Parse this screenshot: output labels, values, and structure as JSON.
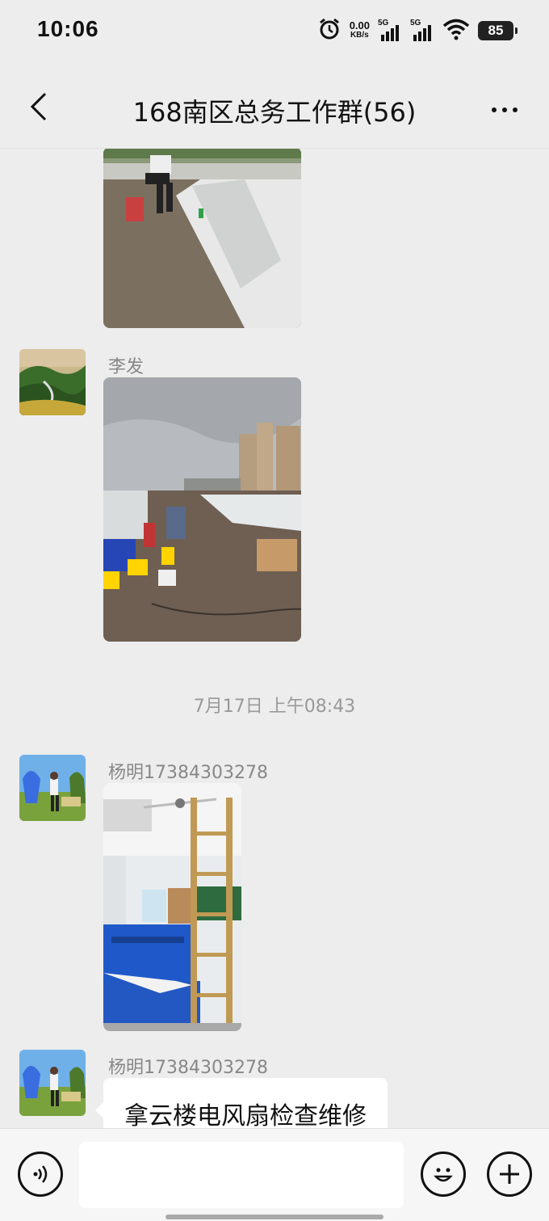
{
  "status_bar": {
    "time": "10:06",
    "net_speed_value": "0.00",
    "net_speed_unit": "KB/s",
    "signal_1_label": "5G",
    "signal_2_label": "5G",
    "battery": "85",
    "icons": [
      "alarm-icon",
      "signal-icon",
      "signal-icon",
      "wifi-icon",
      "battery-icon"
    ]
  },
  "header": {
    "title": "168南区总务工作群(56)",
    "back_icon": "chevron-left-icon",
    "more_icon": "more-dots-icon"
  },
  "messages": [
    {
      "type": "image",
      "sender": "",
      "description_icon": "photo-roof-worker"
    },
    {
      "type": "image",
      "sender": "李发",
      "description_icon": "photo-rooftop-construction"
    },
    {
      "type": "timestamp",
      "text": "7月17日 上午08:43"
    },
    {
      "type": "image",
      "sender": "杨明17384303278",
      "description_icon": "photo-classroom-fan"
    },
    {
      "type": "text",
      "sender": "杨明17384303278",
      "text": "拿云楼电风扇检查维修"
    }
  ],
  "input_bar": {
    "voice_icon": "voice-icon",
    "emoji_icon": "emoji-icon",
    "plus_icon": "plus-icon",
    "placeholder": ""
  },
  "colors": {
    "background": "#ededed",
    "bubble": "#ffffff",
    "meta_text": "#888888"
  }
}
